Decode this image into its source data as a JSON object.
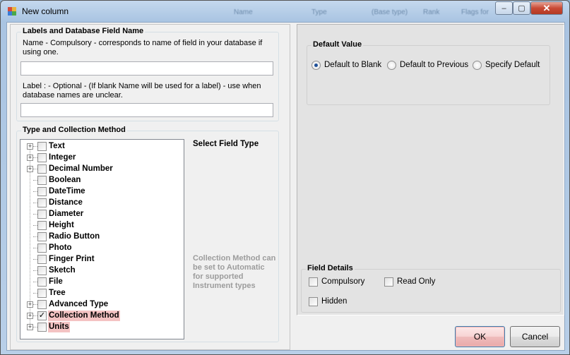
{
  "window": {
    "title": "New column"
  },
  "background_headers": [
    "Name",
    "Type",
    "(Base type)",
    "Rank",
    "Flags for"
  ],
  "caption_buttons": {
    "minimize": "–",
    "maximize": "▢",
    "close": "✕"
  },
  "labels_group": {
    "title": "Labels and Database Field Name",
    "name_help": "Name - Compulsory - corresponds  to  name of field in your database if using one.",
    "name_value": "",
    "label_help": "Label : - Optional -  (If blank  Name will be used for a label) - use when database names are unclear.",
    "label_value": ""
  },
  "type_group": {
    "title": "Type and Collection Method",
    "select_field_type": "Select Field Type",
    "hint": "Collection Method can be set to Automatic for supported Instrument types",
    "items": [
      {
        "label": "Text",
        "expandable": true,
        "checked": false,
        "highlight": false
      },
      {
        "label": "Integer",
        "expandable": true,
        "checked": false,
        "highlight": false
      },
      {
        "label": "Decimal Number",
        "expandable": true,
        "checked": false,
        "highlight": false
      },
      {
        "label": "Boolean",
        "expandable": false,
        "checked": false,
        "highlight": false
      },
      {
        "label": "DateTime",
        "expandable": false,
        "checked": false,
        "highlight": false
      },
      {
        "label": "Distance",
        "expandable": false,
        "checked": false,
        "highlight": false
      },
      {
        "label": "Diameter",
        "expandable": false,
        "checked": false,
        "highlight": false
      },
      {
        "label": "Height",
        "expandable": false,
        "checked": false,
        "highlight": false
      },
      {
        "label": "Radio Button",
        "expandable": false,
        "checked": false,
        "highlight": false
      },
      {
        "label": "Photo",
        "expandable": false,
        "checked": false,
        "highlight": false
      },
      {
        "label": "Finger Print",
        "expandable": false,
        "checked": false,
        "highlight": false
      },
      {
        "label": "Sketch",
        "expandable": false,
        "checked": false,
        "highlight": false
      },
      {
        "label": "File",
        "expandable": false,
        "checked": false,
        "highlight": false
      },
      {
        "label": "Tree",
        "expandable": false,
        "checked": false,
        "highlight": false
      },
      {
        "label": "Advanced Type",
        "expandable": true,
        "checked": false,
        "highlight": false
      },
      {
        "label": "Collection Method",
        "expandable": true,
        "checked": true,
        "highlight": true
      },
      {
        "label": "Units",
        "expandable": true,
        "checked": false,
        "highlight": true
      }
    ]
  },
  "default_value": {
    "title": "Default Value",
    "options": [
      "Default to Blank",
      "Default to Previous",
      "Specify Default"
    ],
    "selected": "Default to Blank"
  },
  "field_details": {
    "title": "Field Details",
    "compulsory": "Compulsory",
    "read_only": "Read Only",
    "hidden": "Hidden"
  },
  "buttons": {
    "ok": "OK",
    "cancel": "Cancel"
  },
  "colors": {
    "highlight": "#f4c3c3",
    "title_bar": "#b8cfe8",
    "hint_text": "#9c9c9c"
  }
}
